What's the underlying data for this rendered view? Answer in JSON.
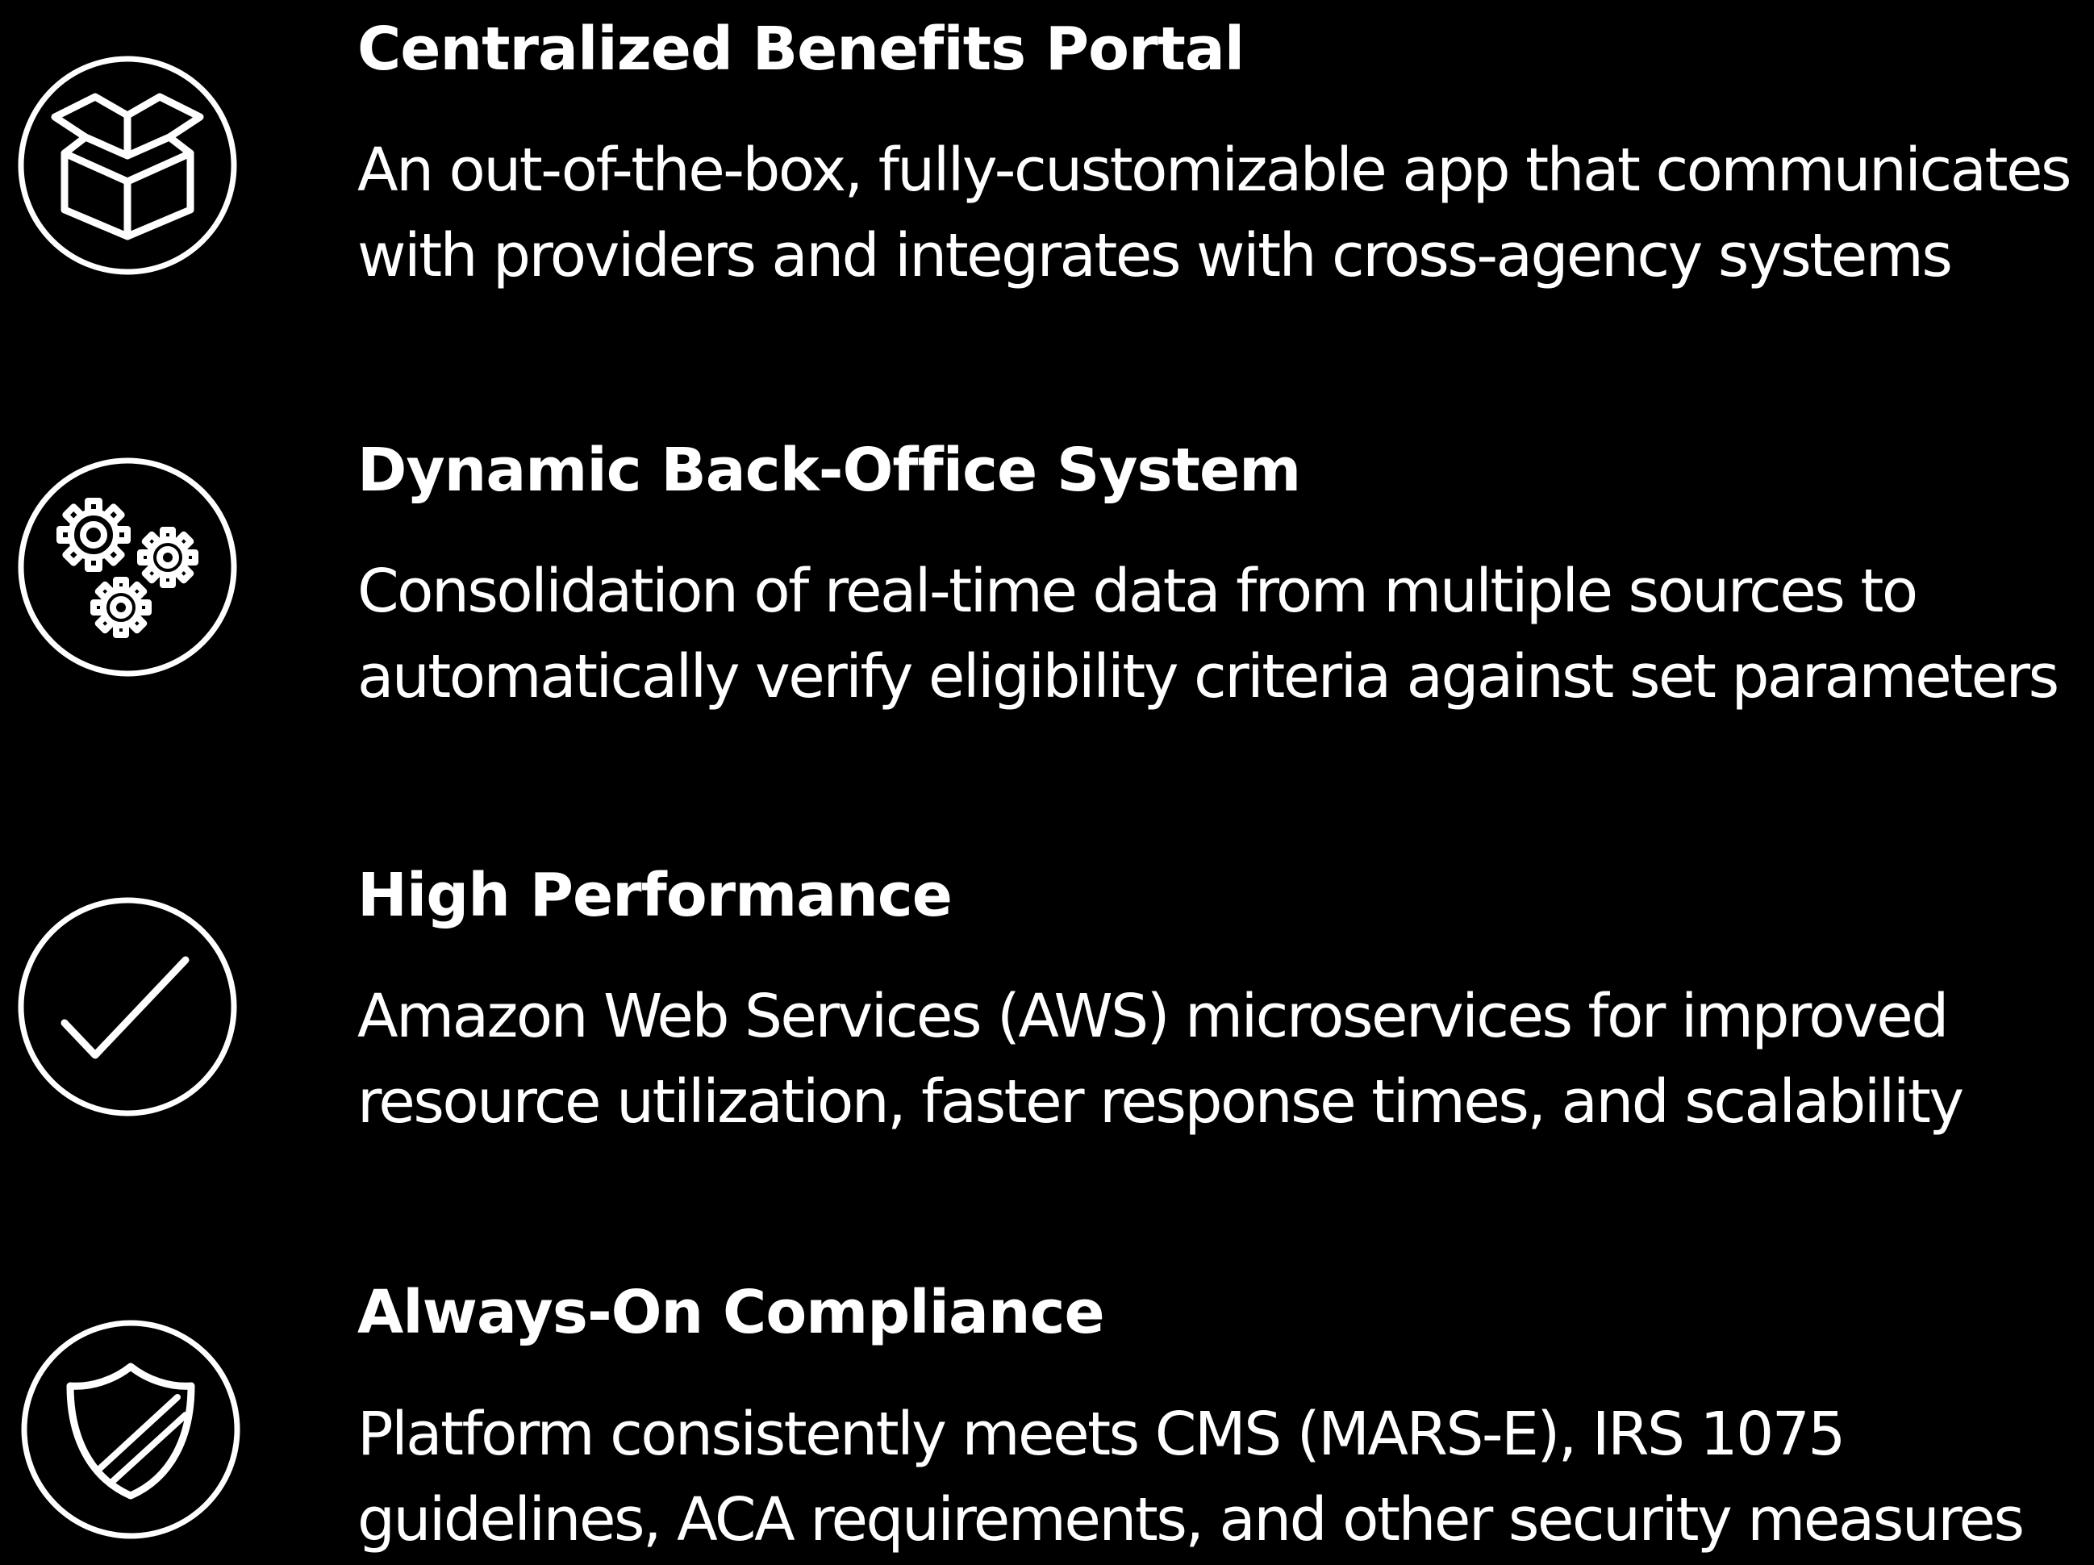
{
  "colors": {
    "background": "#000000",
    "foreground": "#ffffff"
  },
  "features": [
    {
      "icon": "open-box-icon",
      "title": "Centralized Benefits Portal",
      "lines": [
        "An out-of-the-box, fully-customizable app that communicates",
        "with providers and integrates with cross-agency systems"
      ]
    },
    {
      "icon": "gears-icon",
      "title": "Dynamic Back-Office System",
      "lines": [
        "Consolidation of real-time data from multiple sources to",
        "automatically verify eligibility criteria against set parameters"
      ]
    },
    {
      "icon": "checkmark-icon",
      "title": "High Performance",
      "lines": [
        "Amazon Web Services (AWS) microservices for improved",
        "resource utilization, faster response times, and scalability"
      ]
    },
    {
      "icon": "shield-icon",
      "title": "Always-On Compliance",
      "lines": [
        "Platform consistently meets CMS (MARS-E), IRS 1075",
        "guidelines, ACA requirements, and other security measures"
      ]
    }
  ]
}
